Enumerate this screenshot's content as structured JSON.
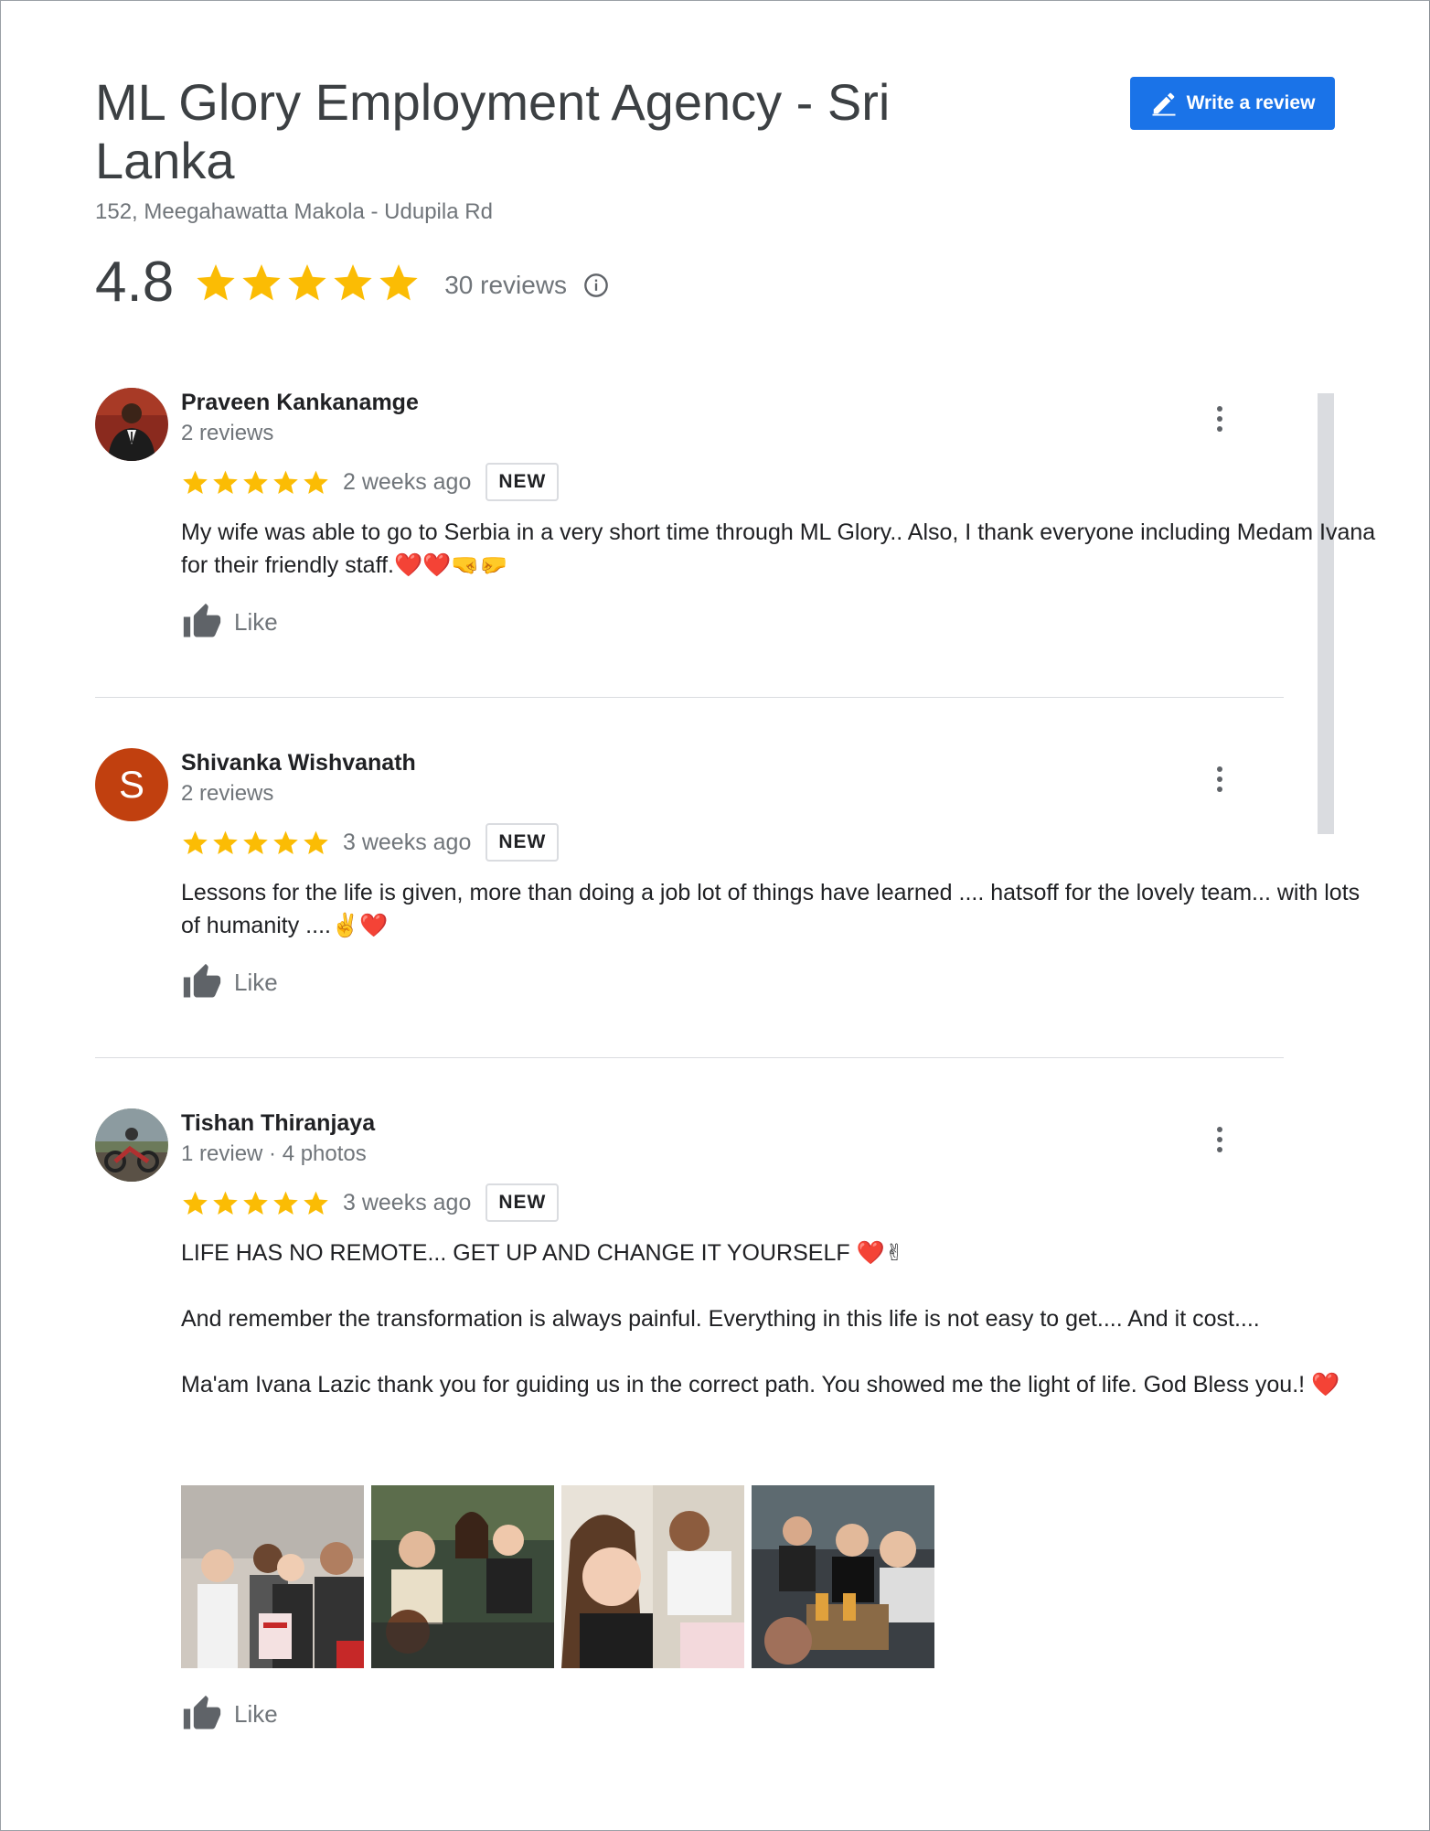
{
  "place": {
    "title": "ML Glory Employment Agency - Sri Lanka",
    "address": "152, Meegahawatta Makola - Udupila Rd",
    "rating": "4.8",
    "stars": 5,
    "review_count": "30 reviews",
    "info_icon": "info-icon"
  },
  "actions": {
    "write_review_label": "Write a review",
    "write_review_icon": "pencil-icon"
  },
  "colors": {
    "star": "#fbbc04",
    "accent": "#1a73e8",
    "avatar_s": "#c1400f"
  },
  "reviews": [
    {
      "name": "Praveen Kankanamge",
      "meta": "2 reviews",
      "stars": 5,
      "date": "2 weeks ago",
      "badge": "NEW",
      "text": "My wife was able to go to Serbia in a very short time through ML Glory.. Also, I thank everyone including Medam Ivana for their friendly staff.❤️❤️🤜🤛",
      "like_label": "Like"
    },
    {
      "name": "Shivanka Wishvanath",
      "avatar_letter": "S",
      "meta": "2 reviews",
      "stars": 5,
      "date": "3 weeks ago",
      "badge": "NEW",
      "text": "Lessons for the life is given, more than doing a job lot of things have learned .... hatsoff for the lovely team... with lots of humanity ....✌️❤️",
      "like_label": "Like"
    },
    {
      "name": "Tishan Thiranjaya",
      "meta": "1 review · 4 photos",
      "stars": 5,
      "date": "3 weeks ago",
      "badge": "NEW",
      "text": "LIFE HAS NO REMOTE... GET UP AND CHANGE IT YOURSELF ❤️✌\n\nAnd remember the transformation is always painful. Everything in this life is not easy to get.... And it cost....\n\nMa'am Ivana Lazic thank you for guiding us in the correct path. You showed me the light of life. God Bless you.! ❤️",
      "like_label": "Like"
    }
  ]
}
